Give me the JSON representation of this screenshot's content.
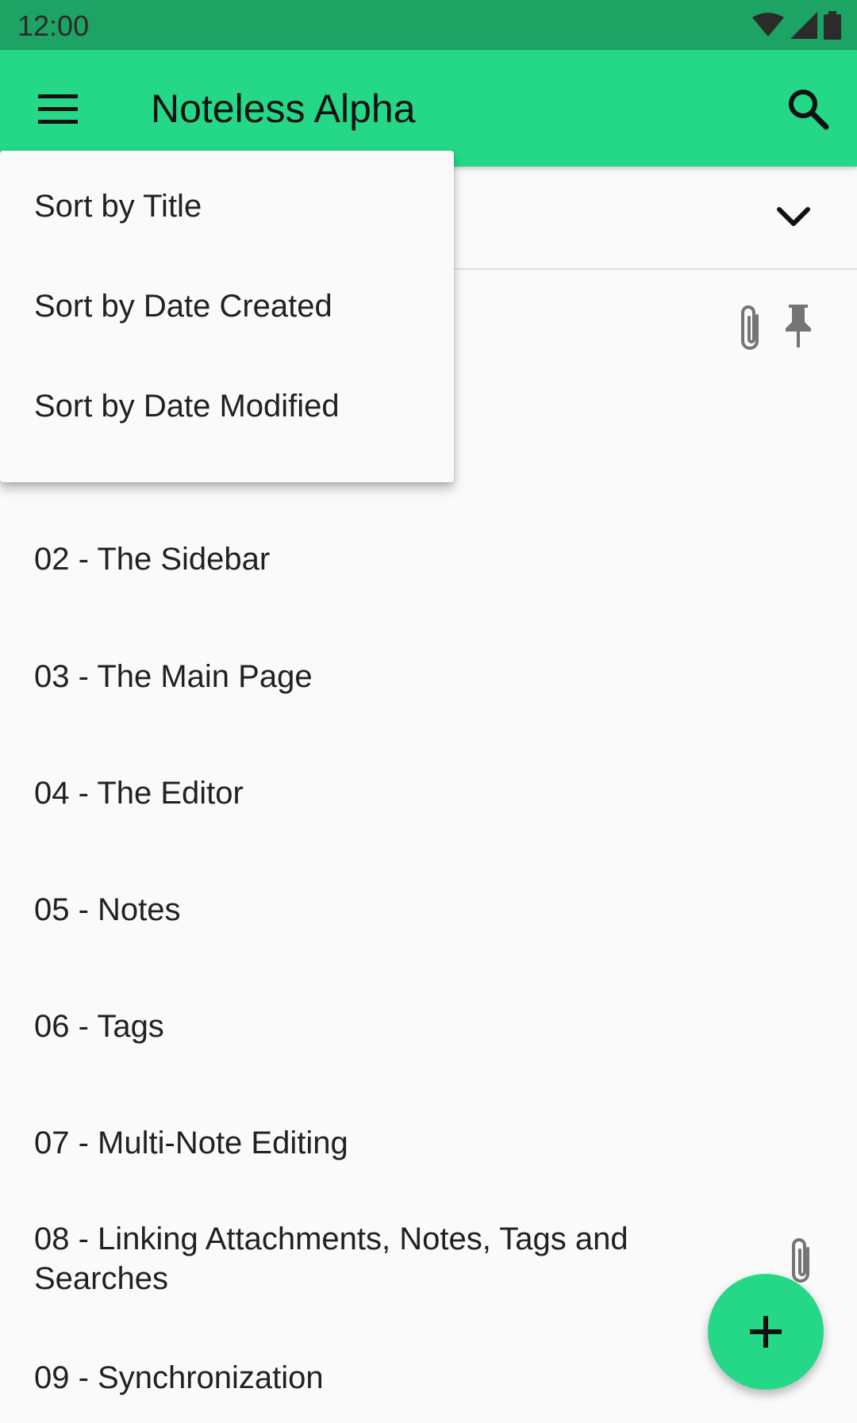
{
  "status_bar": {
    "time": "12:00"
  },
  "app_bar": {
    "title": "Noteless Alpha"
  },
  "sort_menu": {
    "items": [
      {
        "label": "Sort by Title"
      },
      {
        "label": "Sort by Date Created"
      },
      {
        "label": "Sort by Date Modified"
      }
    ]
  },
  "notes": [
    {
      "title": "02 - The Sidebar"
    },
    {
      "title": "03 - The Main Page"
    },
    {
      "title": "04 - The Editor"
    },
    {
      "title": "05 - Notes"
    },
    {
      "title": "06 - Tags"
    },
    {
      "title": "07 - Multi-Note Editing"
    },
    {
      "title": "08 - Linking Attachments, Notes, Tags and Searches"
    },
    {
      "title": "09 - Synchronization"
    }
  ],
  "colors": {
    "primary": "#24d887",
    "status_bar": "#1da364",
    "background": "#fafafa"
  },
  "icons": {
    "menu": "menu-icon",
    "search": "search-icon",
    "chevron": "chevron-down-icon",
    "attachment": "paperclip-icon",
    "pin": "pin-icon",
    "add": "plus-icon"
  }
}
